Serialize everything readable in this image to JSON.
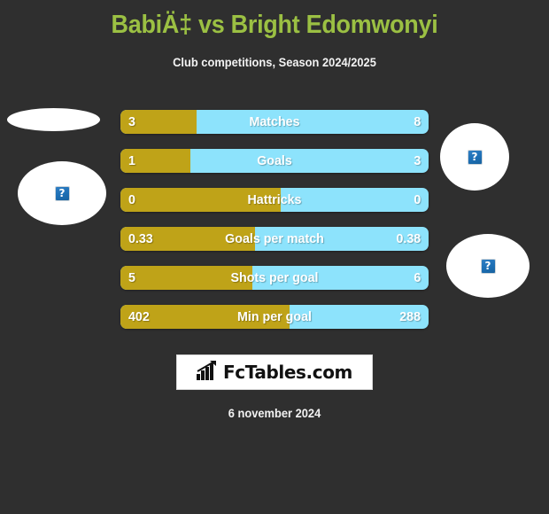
{
  "page": {
    "title": "BabiÄ‡ vs Bright Edomwonyi",
    "subtitle": "Club competitions, Season 2024/2025",
    "date": "6 november 2024",
    "background_color": "#2f2f2f",
    "title_color": "#9bc043",
    "home_color": "#bfa318",
    "away_color": "#8de3fc"
  },
  "players": {
    "home": {
      "name": "BabiÄ‡",
      "photo_placeholder": "broken-image-icon",
      "photo_alt_glyph": "?"
    },
    "away": {
      "name": "Bright Edomwonyi",
      "photo_placeholder": "broken-image-icon",
      "photo_alt_glyph": "?"
    }
  },
  "logo": {
    "text": "FcTables.com",
    "icon": "bar-chart-icon"
  },
  "chart_data": {
    "type": "bar",
    "title": "BabiÄ‡ vs Bright Edomwonyi",
    "subtitle": "Club competitions, Season 2024/2025",
    "xlabel": "",
    "ylabel": "",
    "legend": [
      "BabiÄ‡",
      "Bright Edomwonyi"
    ],
    "legend_position": "none",
    "grid": false,
    "orientation": "horizontal-diverging",
    "categories": [
      "Matches",
      "Goals",
      "Hattricks",
      "Goals per match",
      "Shots per goal",
      "Min per goal"
    ],
    "series": [
      {
        "name": "BabiÄ‡",
        "color": "#bfa318",
        "values": [
          3,
          1,
          0,
          0.33,
          5,
          402
        ],
        "display": [
          "3",
          "1",
          "0",
          "0.33",
          "5",
          "402"
        ]
      },
      {
        "name": "Bright Edomwonyi",
        "color": "#8de3fc",
        "values": [
          8,
          3,
          0,
          0.38,
          6,
          288
        ],
        "display": [
          "8",
          "3",
          "0",
          "0.38",
          "6",
          "288"
        ]
      }
    ],
    "rows": [
      {
        "label": "Matches",
        "left_value": "3",
        "right_value": "8",
        "left_share_pct": 24.7
      },
      {
        "label": "Goals",
        "left_value": "1",
        "right_value": "3",
        "left_share_pct": 22.8
      },
      {
        "label": "Hattricks",
        "left_value": "0",
        "right_value": "0",
        "left_share_pct": 52.0
      },
      {
        "label": "Goals per match",
        "left_value": "0.33",
        "right_value": "0.38",
        "left_share_pct": 43.6
      },
      {
        "label": "Shots per goal",
        "left_value": "5",
        "right_value": "6",
        "left_share_pct": 42.9
      },
      {
        "label": "Min per goal",
        "left_value": "402",
        "right_value": "288",
        "left_share_pct": 55.0
      }
    ]
  }
}
